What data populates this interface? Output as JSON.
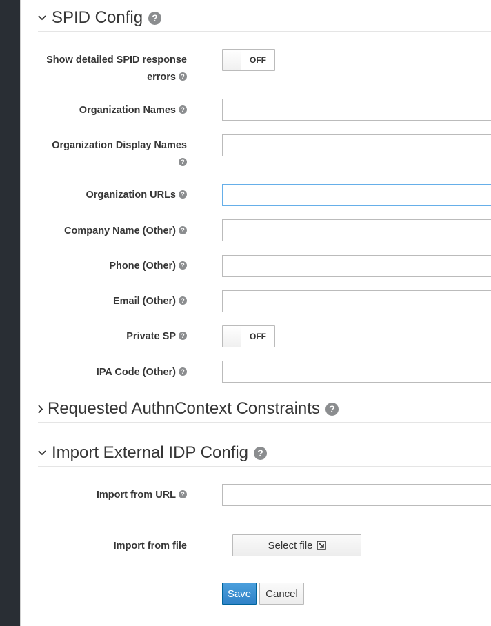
{
  "spid_section": {
    "title": "SPID Config",
    "help": "?",
    "fields": [
      {
        "label_line1": "Show detailed SPID response",
        "label_line2": "errors",
        "toggle": "OFF"
      },
      {
        "label": "Organization Names",
        "value": ""
      },
      {
        "label_line1": "Organization Display Names",
        "value": ""
      },
      {
        "label": "Organization URLs",
        "value": ""
      },
      {
        "label": "Company Name (Other)",
        "value": ""
      },
      {
        "label": "Phone (Other)",
        "value": ""
      },
      {
        "label": "Email (Other)",
        "value": ""
      },
      {
        "label": "Private SP",
        "toggle": "OFF"
      },
      {
        "label": "IPA Code (Other)",
        "value": ""
      }
    ]
  },
  "authn_section": {
    "title": "Requested AuthnContext Constraints",
    "help": "?"
  },
  "import_section": {
    "title": "Import External IDP Config",
    "help": "?",
    "import_url_label": "Import from URL",
    "import_url_value": "",
    "import_file_label": "Import from file",
    "select_file_label": "Select file"
  },
  "actions": {
    "save": "Save",
    "cancel": "Cancel"
  },
  "colors": {
    "rail": "#292e34",
    "primary": "#3e8fd0",
    "help_icon": "#8b8d8f"
  }
}
